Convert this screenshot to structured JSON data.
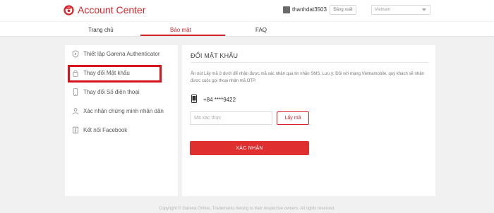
{
  "header": {
    "logo_text": "Account Center",
    "username": "thanhdat3503",
    "logout_label": "Đăng xuất",
    "language": "Vietnam"
  },
  "nav": {
    "tabs": [
      {
        "label": "Trang chủ",
        "active": false
      },
      {
        "label": "Bảo mật",
        "active": true
      },
      {
        "label": "FAQ",
        "active": false
      }
    ]
  },
  "sidebar": {
    "items": [
      {
        "label": "Thiết lập Garena Authenticator",
        "icon": "shield-icon"
      },
      {
        "label": "Thay đổi Mật khẩu",
        "icon": "lock-icon",
        "selected": true
      },
      {
        "label": "Thay đổi Số điện thoại",
        "icon": "phone-icon"
      },
      {
        "label": "Xác nhận chứng minh nhân dân",
        "icon": "id-card-icon"
      },
      {
        "label": "Kết nối Facebook",
        "icon": "facebook-icon"
      }
    ]
  },
  "main": {
    "title": "ĐỔI MẬT KHẨU",
    "description": "Ấn nút Lấy mã ở dưới để nhận được mã xác nhận qua tin nhắn SMS. Lưu ý: Đối với mạng Vietnamobile, quý khách sẽ nhận được cuộc gọi thoại nhận mã OTP.",
    "phone": "+84 ****9422",
    "code_placeholder": "Mã xác thực",
    "code_value": "",
    "get_code_label": "Lấy mã",
    "confirm_label": "XÁC NHẬN"
  },
  "footer": {
    "text": "Copyright © Garena Online. Trademarks belong to their respective owners. All rights reserved."
  },
  "colors": {
    "accent": "#d6232a",
    "button": "#e02f2f",
    "highlight_box": "#d8131c",
    "background": "#f1f1f1"
  }
}
